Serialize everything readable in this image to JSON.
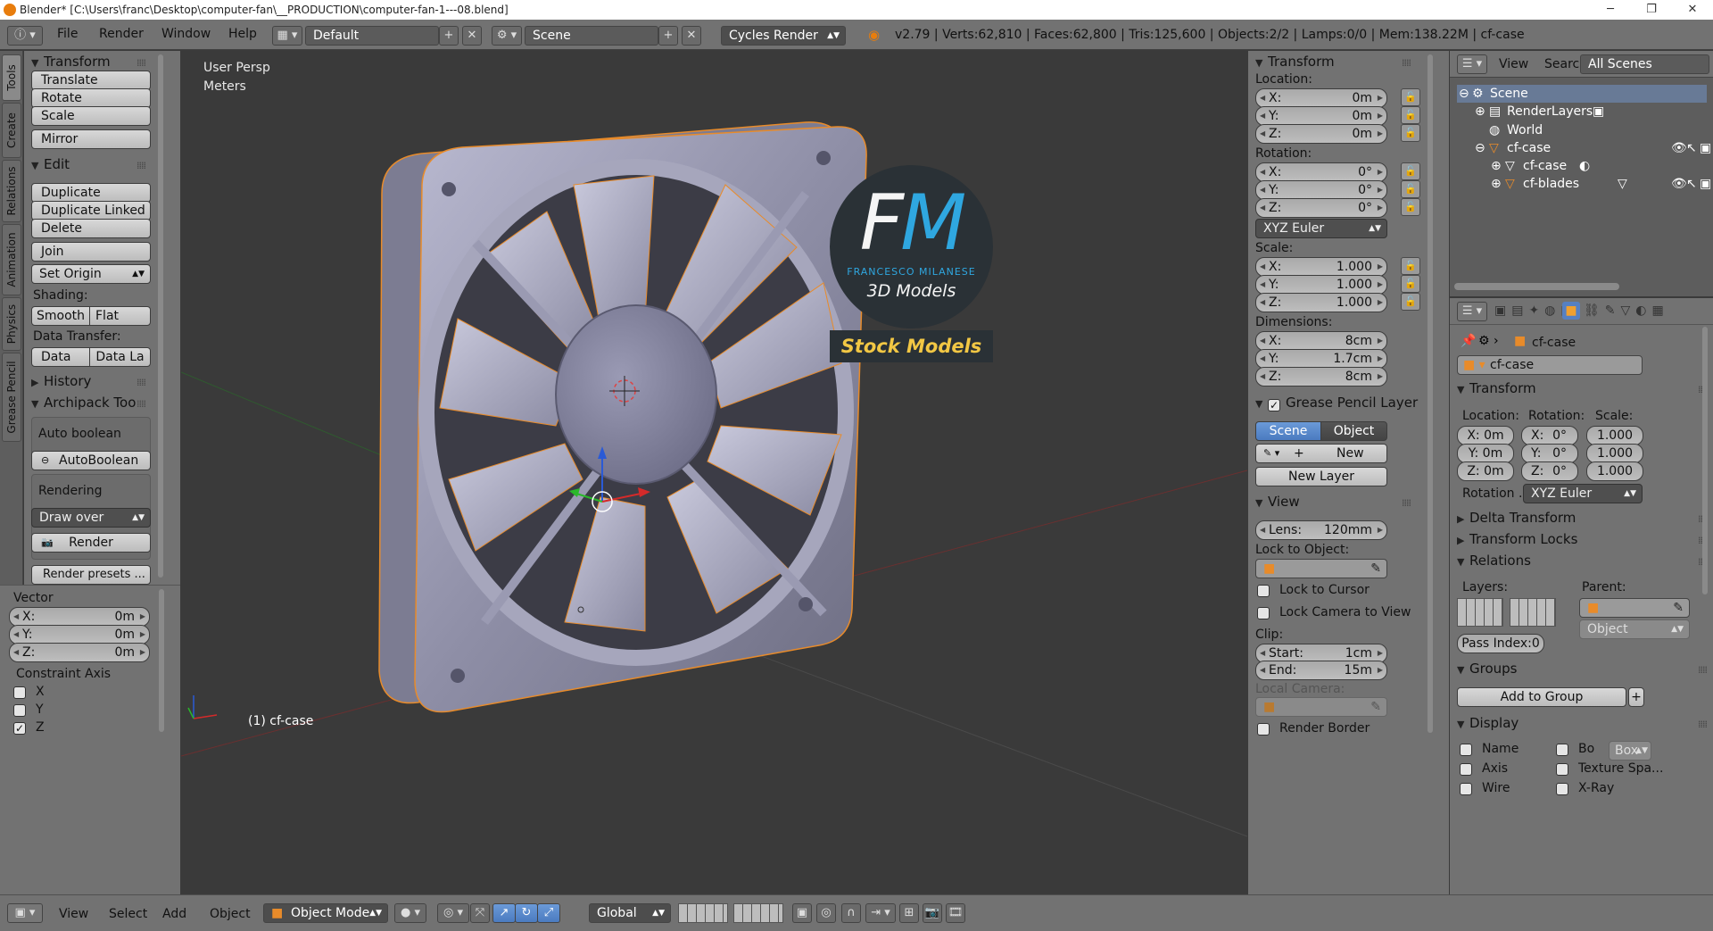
{
  "title_bar": {
    "text": "Blender* [C:\\Users\\franc\\Desktop\\computer-fan\\__PRODUCTION\\computer-fan-1---08.blend]"
  },
  "menu": {
    "file": "File",
    "render": "Render",
    "window": "Window",
    "help": "Help"
  },
  "layout_field": "Default",
  "scene_field": "Scene",
  "engine": "Cycles Render",
  "stats": "v2.79 | Verts:62,810 | Faces:62,800 | Tris:125,600 | Objects:2/2 | Lamps:0/0 | Mem:138.22M | cf-case",
  "left_tabs": [
    "Tools",
    "Create",
    "Relations",
    "Animation",
    "Physics",
    "Grease Pencil"
  ],
  "tools": {
    "transform_header": "Transform",
    "translate": "Translate",
    "rotate": "Rotate",
    "scale": "Scale",
    "mirror": "Mirror",
    "edit_header": "Edit",
    "duplicate": "Duplicate",
    "duplicate_linked": "Duplicate Linked",
    "delete": "Delete",
    "join": "Join",
    "set_origin": "Set Origin",
    "shading_label": "Shading:",
    "smooth": "Smooth",
    "flat": "Flat",
    "data_transfer_label": "Data Transfer:",
    "data": "Data",
    "data_la": "Data La",
    "history_header": "History",
    "archipack_header": "Archipack Too",
    "auto_boolean_label": "Auto boolean",
    "autoboolean_btn": "AutoBoolean",
    "rendering_label": "Rendering",
    "draw_over": "Draw over",
    "render_btn": "Render",
    "render_presets": "Render presets ..."
  },
  "operator": {
    "header": "Vector",
    "x": "X:",
    "y": "Y:",
    "z": "Z:",
    "xv": "0m",
    "yv": "0m",
    "zv": "0m",
    "constraint_label": "Constraint Axis",
    "cx": "X",
    "cy": "Y",
    "cz": "Z",
    "cz_checked": true
  },
  "viewport": {
    "view_name": "User Persp",
    "units": "Meters",
    "object_label": "(1) cf-case",
    "logo_letters": "FM",
    "logo_name": "FRANCESCO MILANESE",
    "logo_sub": "3D Models",
    "logo_banner": "Stock Models"
  },
  "npanel": {
    "transform_header": "Transform",
    "location_label": "Location:",
    "loc": {
      "x": "0m",
      "y": "0m",
      "z": "0m"
    },
    "rotation_label": "Rotation:",
    "rot": {
      "x": "0°",
      "y": "0°",
      "z": "0°"
    },
    "euler": "XYZ Euler",
    "scale_label": "Scale:",
    "scl": {
      "x": "1.000",
      "y": "1.000",
      "z": "1.000"
    },
    "dimensions_label": "Dimensions:",
    "dim": {
      "x": "8cm",
      "y": "1.7cm",
      "z": "8cm"
    },
    "axis": {
      "x": "X:",
      "y": "Y:",
      "z": "Z:"
    },
    "gp_header": "Grease Pencil Layer",
    "gp_scene": "Scene",
    "gp_object": "Object",
    "gp_new": "New",
    "gp_new_layer": "New Layer",
    "view_header": "View",
    "lens_label": "Lens:",
    "lens_value": "120mm",
    "lock_to_object": "Lock to Object:",
    "lock_to_cursor": "Lock to Cursor",
    "lock_camera": "Lock Camera to View",
    "clip_label": "Clip:",
    "start_label": "Start:",
    "start_value": "1cm",
    "end_label": "End:",
    "end_value": "15m",
    "local_camera": "Local Camera:",
    "render_border": "Render Border"
  },
  "outliner": {
    "view": "View",
    "search": "Search",
    "all_scenes": "All Scenes",
    "items": [
      "Scene",
      "RenderLayers",
      "World",
      "cf-case",
      "cf-case",
      "cf-blades"
    ]
  },
  "properties": {
    "breadcrumb": "cf-case",
    "object_name": "cf-case",
    "transform_header": "Transform",
    "location_label": "Location:",
    "rotation_label": "Rotation:",
    "scale_label": "Scale:",
    "loc": [
      "X: 0m",
      "Y: 0m",
      "Z: 0m"
    ],
    "rot": [
      "X:",
      "Y:",
      "Z:"
    ],
    "rot_v": [
      "0°",
      "0°",
      "0°"
    ],
    "scl": [
      "1.000",
      "1.000",
      "1.000"
    ],
    "rotation_mode_label": "Rotation ...",
    "rotation_mode": "XYZ Euler",
    "delta_transform": "Delta Transform",
    "transform_locks": "Transform Locks",
    "relations": "Relations",
    "layers_label": "Layers:",
    "parent_label": "Parent:",
    "parent_type": "Object",
    "pass_index": "Pass Index:0",
    "groups_header": "Groups",
    "add_to_group": "Add to Group",
    "display_header": "Display",
    "name": "Name",
    "axis": "Axis",
    "wire": "Wire",
    "bo": "Bo",
    "box": "Box",
    "texture_space": "Texture Spa...",
    "xray": "X-Ray"
  },
  "bottom": {
    "view": "View",
    "select": "Select",
    "add": "Add",
    "object": "Object",
    "mode": "Object Mode",
    "orientation": "Global"
  },
  "colors": {
    "panel": "#727272",
    "viewport": "#3a3a3a",
    "accent_blue": "#5680c2",
    "selection_orange": "#e88b2a",
    "logo_blue": "#2fa7e0",
    "logo_yellow": "#f2c744"
  }
}
